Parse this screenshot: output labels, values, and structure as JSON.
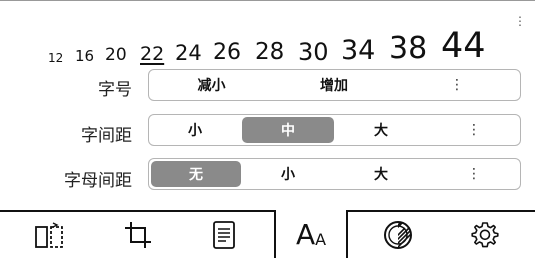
{
  "font_sizes": [
    "12",
    "16",
    "20",
    "22",
    "24",
    "26",
    "28",
    "30",
    "34",
    "38",
    "44"
  ],
  "selected_size": "22",
  "rows": {
    "size": {
      "label": "字号",
      "options": [
        "减小",
        "增加"
      ],
      "more": "⋮"
    },
    "char_spacing": {
      "label": "字间距",
      "options": [
        "小",
        "中",
        "大"
      ],
      "selected": "中",
      "more": "⋮"
    },
    "letter_spacing": {
      "label": "字母间距",
      "options": [
        "无",
        "小",
        "大"
      ],
      "selected": "无",
      "more": "⋮"
    }
  },
  "top_menu": "⋮",
  "toolbar": {
    "items": [
      "page-layout-icon",
      "crop-icon",
      "document-icon",
      "font-icon",
      "contrast-icon",
      "settings-icon"
    ],
    "font_icon_big": "A",
    "font_icon_small": "A",
    "active": "font-icon"
  },
  "colors": {
    "active_segment": "#8a8a8a",
    "border": "#b5b5b5",
    "text": "#111111"
  }
}
